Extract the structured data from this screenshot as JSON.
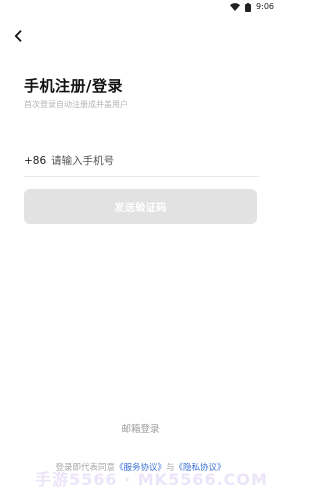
{
  "status_bar": {
    "time": "9:06",
    "icons": [
      "wifi-icon",
      "battery-icon"
    ]
  },
  "header": {
    "back_icon": "chevron-left-icon",
    "title": "手机注册/登录",
    "subtitle": "首次登录自动注册成并盖用户"
  },
  "form": {
    "country_code": "+86",
    "phone_value": "",
    "phone_placeholder": "请输入手机号",
    "send_code_label": "发送验证码"
  },
  "footer": {
    "email_login_label": "邮箱登录",
    "agreement_prefix": "登录即代表同意",
    "service_agreement": "《服务协议》",
    "agreement_and": "与",
    "privacy_agreement": "《隐私协议》"
  },
  "watermark": {
    "text": "手游5566 · MK5566.COM"
  },
  "colors": {
    "link": "#3a6fd8",
    "button_disabled": "#e2e2e2",
    "title": "#111111",
    "muted": "#a8a8a8"
  }
}
